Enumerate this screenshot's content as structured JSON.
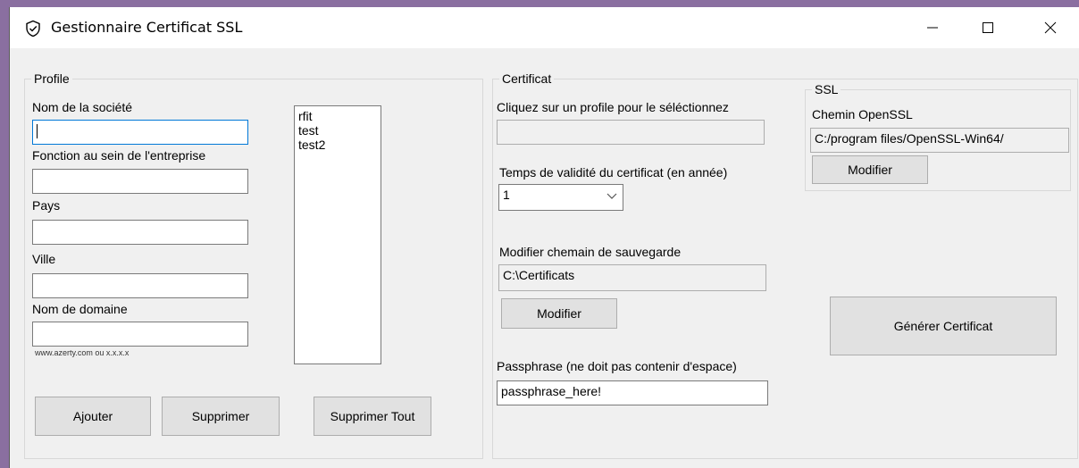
{
  "window": {
    "title": "Gestionnaire Certificat SSL"
  },
  "profile": {
    "legend": "Profile",
    "company_label": "Nom de la société",
    "company_value": "",
    "function_label": "Fonction au sein de l'entreprise",
    "function_value": "",
    "country_label": "Pays",
    "country_value": "",
    "city_label": "Ville",
    "city_value": "",
    "domain_label": "Nom de domaine",
    "domain_value": "",
    "domain_hint": "www.azerty.com ou x.x.x.x",
    "profiles": [
      "rfit",
      "test",
      "test2"
    ],
    "add_button": "Ajouter",
    "delete_button": "Supprimer",
    "delete_all_button": "Supprimer Tout"
  },
  "certificat": {
    "legend": "Certificat",
    "select_profile_label": "Cliquez sur un profile pour le séléctionnez",
    "selected_profile_value": "",
    "validity_label": "Temps de validité du certificat (en année)",
    "validity_value": "1",
    "save_path_label": "Modifier chemain de sauvegarde",
    "save_path_value": "C:\\Certificats",
    "modify_button": "Modifier",
    "passphrase_label": "Passphrase (ne doit pas contenir d'espace)",
    "passphrase_value": "passphrase_here!"
  },
  "ssl": {
    "legend": "SSL",
    "openssl_label": "Chemin OpenSSL",
    "openssl_value": "C:/program files/OpenSSL-Win64/",
    "modify_button": "Modifier"
  },
  "generate_button": "Générer Certificat",
  "icons": {
    "app": "shield-check-icon",
    "minimize": "minimize-icon",
    "maximize": "maximize-icon",
    "close": "close-icon"
  },
  "colors": {
    "focus_border": "#0078d7",
    "button_bg": "#e1e1e1",
    "window_bg": "#f0f0f0"
  }
}
